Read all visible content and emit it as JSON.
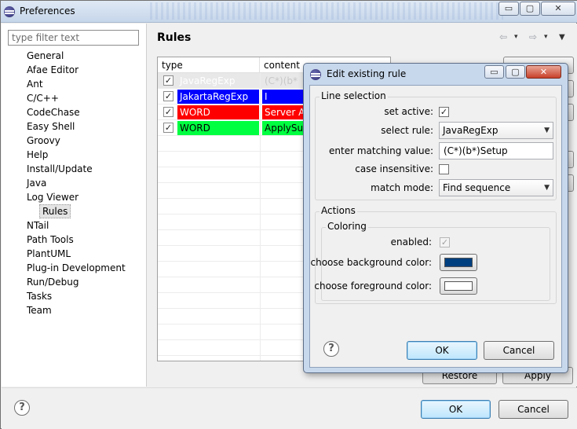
{
  "window": {
    "title": "Preferences",
    "min_glyph": "▭",
    "max_glyph": "▢",
    "close_glyph": "✕"
  },
  "sidebar": {
    "filter_placeholder": "type filter text",
    "items": [
      {
        "label": "General"
      },
      {
        "label": "Afae Editor"
      },
      {
        "label": "Ant"
      },
      {
        "label": "C/C++"
      },
      {
        "label": "CodeChase"
      },
      {
        "label": "Easy Shell"
      },
      {
        "label": "Groovy"
      },
      {
        "label": "Help"
      },
      {
        "label": "Install/Update"
      },
      {
        "label": "Java"
      },
      {
        "label": "Log Viewer"
      },
      {
        "label": "Rules",
        "selected": true
      },
      {
        "label": "NTail"
      },
      {
        "label": "Path Tools"
      },
      {
        "label": "PlantUML"
      },
      {
        "label": "Plug-in Development"
      },
      {
        "label": "Run/Debug"
      },
      {
        "label": "Tasks"
      },
      {
        "label": "Team"
      }
    ]
  },
  "page": {
    "title": "Rules",
    "nav": {
      "back": "⇦",
      "back_menu": "▾",
      "forward": "⇨",
      "forward_menu": "▾",
      "view_menu": "▼"
    }
  },
  "rules_table": {
    "columns": [
      "type",
      "content"
    ],
    "rows": [
      {
        "checked": true,
        "type": "JavaRegExp",
        "content": "(C*)(b*",
        "type_color": "#e8e8e8",
        "selected": true
      },
      {
        "checked": true,
        "type": "JakartaRegExp",
        "content": "I",
        "type_color": "#0000ff",
        "content_color": "#0000ff"
      },
      {
        "checked": true,
        "type": "WORD",
        "content": "Server Ap",
        "type_color": "#ff0000",
        "content_color": "#ff0000"
      },
      {
        "checked": true,
        "type": "WORD",
        "content": "ApplySuc",
        "type_color": "#00ff40",
        "content_color": "#00ff40"
      }
    ],
    "check_glyph": "✓"
  },
  "buttons": {
    "restore_defaults": "Restore Defaults",
    "apply": "Apply",
    "ok": "OK",
    "cancel": "Cancel",
    "help_glyph": "?"
  },
  "dialog": {
    "title": "Edit existing rule",
    "line_selection": {
      "group_label": "Line selection",
      "set_active_label": "set active:",
      "set_active": true,
      "select_rule_label": "select rule:",
      "select_rule_value": "JavaRegExp",
      "matching_label": "enter matching value:",
      "matching_value": "(C*)(b*)Setup",
      "case_label": "case insensitive:",
      "case_insensitive": false,
      "match_mode_label": "match mode:",
      "match_mode_value": "Find sequence"
    },
    "actions": {
      "group_label": "Actions",
      "coloring_label": "Coloring",
      "enabled_label": "enabled:",
      "enabled": true,
      "bg_label": "choose background color:",
      "bg_color": "#003f7f",
      "fg_label": "choose foreground color:",
      "fg_color": "#ffffff"
    },
    "ok": "OK",
    "cancel": "Cancel",
    "help_glyph": "?",
    "min_glyph": "▭",
    "max_glyph": "▢",
    "close_glyph": "✕"
  }
}
